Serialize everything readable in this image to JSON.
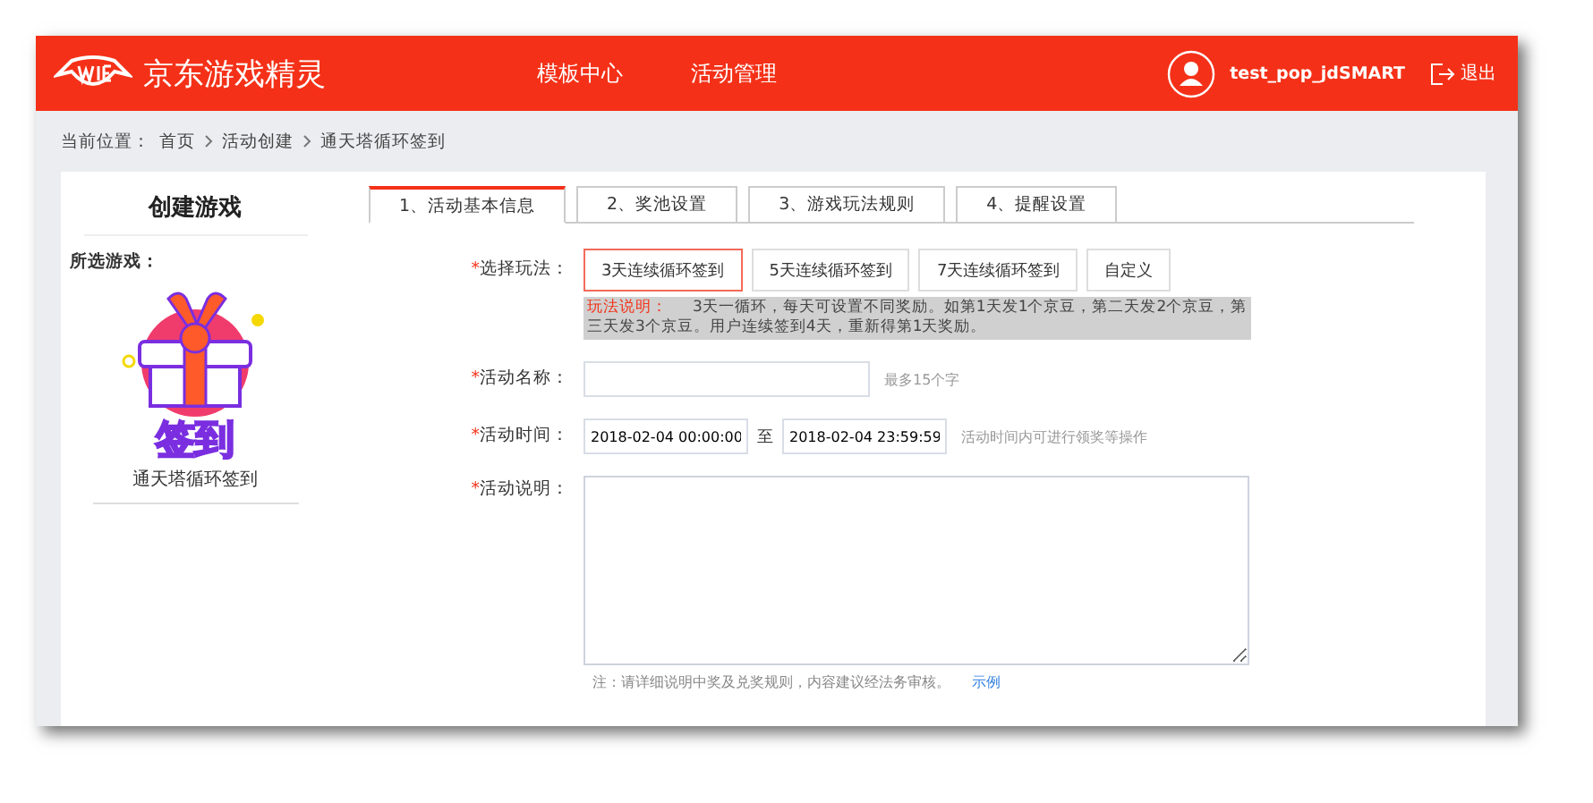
{
  "header": {
    "brand": "京东游戏精灵",
    "nav": [
      {
        "label": "模板中心",
        "selected": false
      },
      {
        "label": "活动管理",
        "selected": false
      }
    ],
    "username": "test_pop_jdSMART",
    "logout": "退出"
  },
  "breadcrumb": {
    "label": "当前位置：",
    "items": [
      "首页",
      "活动创建",
      "通天塔循环签到"
    ]
  },
  "sidebar": {
    "title": "创建游戏",
    "section_label": "所选游戏：",
    "game": {
      "badge_text": "签到",
      "name": "通天塔循环签到"
    }
  },
  "tabs": [
    {
      "label": "1、活动基本信息",
      "selected": true
    },
    {
      "label": "2、奖池设置",
      "selected": false
    },
    {
      "label": "3、游戏玩法规则",
      "selected": false
    },
    {
      "label": "4、提醒设置",
      "selected": false
    }
  ],
  "form": {
    "play_mode": {
      "label": "选择玩法：",
      "required_mark": "*",
      "options": [
        {
          "label": "3天连续循环签到",
          "selected": true
        },
        {
          "label": "5天连续循环签到",
          "selected": false
        },
        {
          "label": "7天连续循环签到",
          "selected": false
        },
        {
          "label": "自定义",
          "selected": false
        }
      ],
      "note_label": "玩法说明：",
      "note": "3天一循环，每天可设置不同奖励。如第1天发1个京豆，第二天发2个京豆，第三天发3个京豆。用户连续签到4天，重新得第1天奖励。"
    },
    "name": {
      "label": "活动名称：",
      "required_mark": "*",
      "hint": "最多15个字"
    },
    "time": {
      "label": "活动时间：",
      "required_mark": "*",
      "start": "2018-02-04 00:00:00",
      "separator": "至",
      "end": "2018-02-04 23:59:59",
      "hint": "活动时间内可进行领奖等操作"
    },
    "description": {
      "label": "活动说明：",
      "required_mark": "*",
      "note": "注：请详细说明中奖及兑奖规则，内容建议经法务审核。",
      "link": "示例"
    }
  }
}
